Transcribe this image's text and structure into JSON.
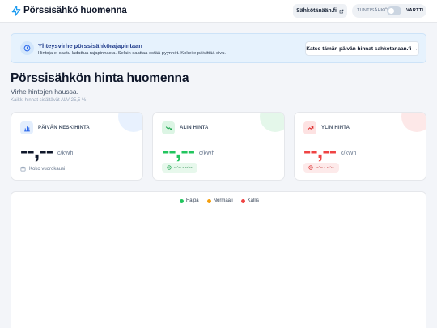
{
  "header": {
    "brand": "Pörssisähkö huomenna",
    "ext_link_label": "Sähkötänään.fi",
    "toggle_left": "TUNTISÄHKÖ",
    "toggle_right": "VARTTI"
  },
  "alert": {
    "title": "Yhteysvirhe pörssisähkörajapintaan",
    "text": "Hintoja ei saatu ladattua rajapinnasta. Selain saattaa estää pyynnöt. Kokeile päivittää sivu.",
    "button": "Katso tämän päivän hinnat sahkotanaan.fi →"
  },
  "page": {
    "title": "Pörssisähkön hinta huomenna",
    "subtitle": "Virhe hintojen haussa.",
    "vat_note": "Kaikki hinnat sisältävät ALV 25,5 %"
  },
  "cards": [
    {
      "title": "PÄIVÄN KESKIHINTA",
      "value": "--,--",
      "unit": "c/kWh",
      "footer": "Koko vuorokausi",
      "color": "#0f172a",
      "icon": "bar-chart-icon"
    },
    {
      "title": "ALIN HINTA",
      "value": "--,--",
      "unit": "c/kWh",
      "time": "--:-- - --:--",
      "color": "#22c55e",
      "icon": "trend-down-icon"
    },
    {
      "title": "YLIN HINTA",
      "value": "--,--",
      "unit": "c/kWh",
      "time": "--:-- - --:--",
      "color": "#ef4444",
      "icon": "trend-up-icon"
    }
  ],
  "legend": [
    {
      "label": "Halpa",
      "color": "#22c55e"
    },
    {
      "label": "Normaali",
      "color": "#f59e0b"
    },
    {
      "label": "Kallis",
      "color": "#ef4444"
    }
  ]
}
